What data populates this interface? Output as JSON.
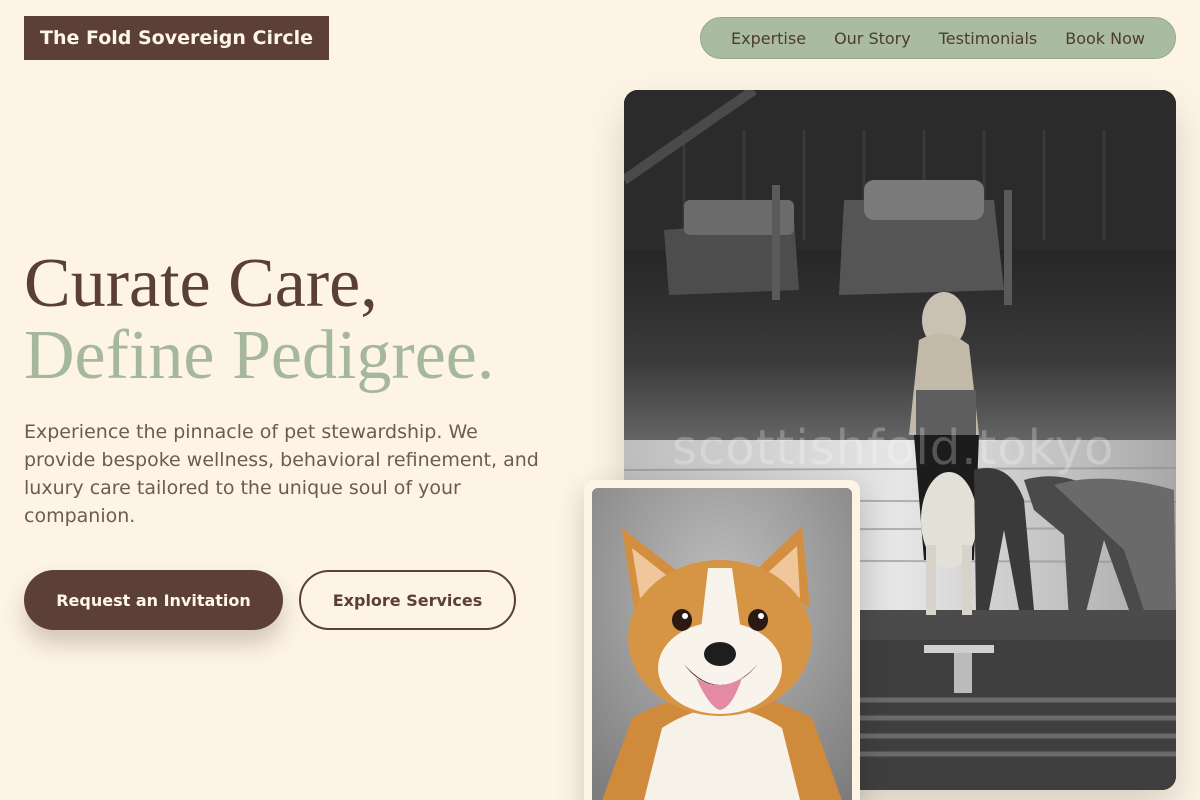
{
  "brand": {
    "name": "The Fold Sovereign Circle"
  },
  "nav": {
    "items": [
      {
        "label": "Expertise"
      },
      {
        "label": "Our Story"
      },
      {
        "label": "Testimonials"
      },
      {
        "label": "Book Now"
      }
    ]
  },
  "hero": {
    "headline_line1": "Curate Care,",
    "headline_line2": "Define Pedigree.",
    "lede": "Experience the pinnacle of pet stewardship. We provide bespoke wellness, behavioral refinement, and luxury care tailored to the unique soul of your companion.",
    "primary_cta": "Request an Invitation",
    "secondary_cta": "Explore Services"
  },
  "media": {
    "main_watermark": "scottishfold.tokyo"
  },
  "colors": {
    "background": "#fdf4e6",
    "brand_brown": "#5c4037",
    "sage": "#a9bca0",
    "text_muted": "#6e5a54"
  }
}
